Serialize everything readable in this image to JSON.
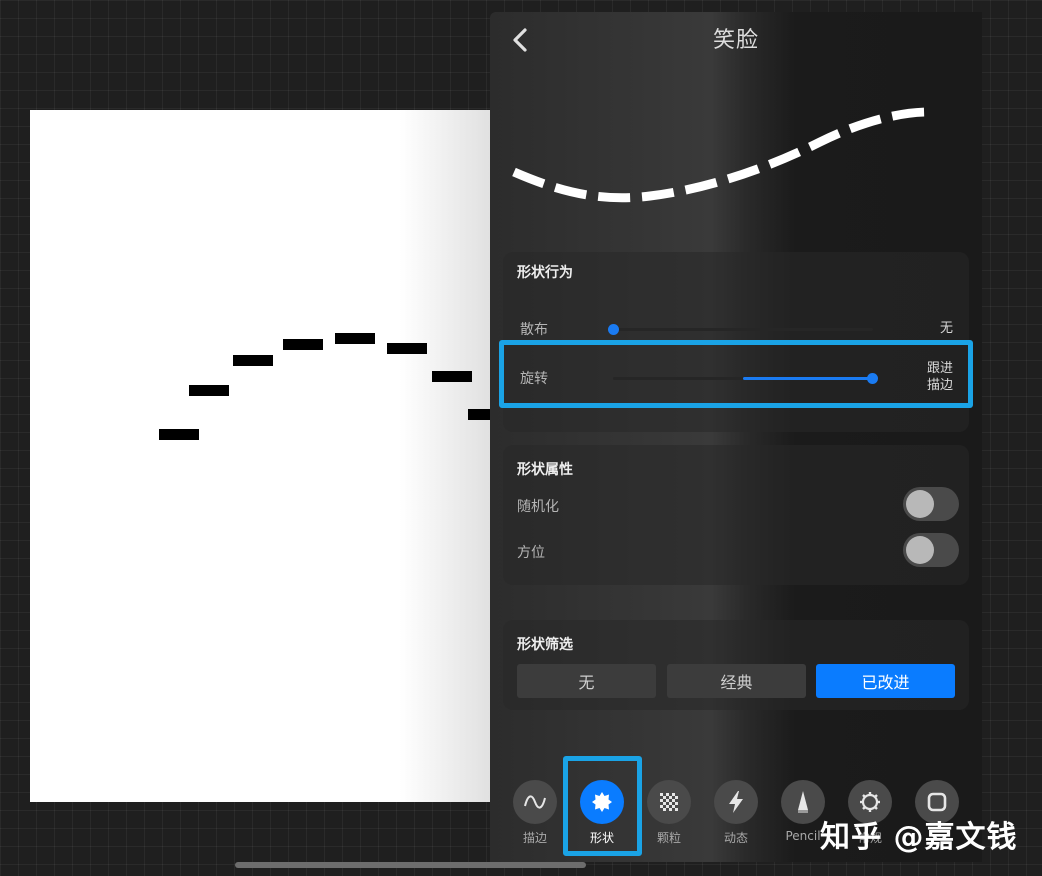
{
  "panel": {
    "title": "笑脸"
  },
  "shape_behavior": {
    "title": "形状行为",
    "scatter": {
      "label": "散布",
      "value": "无",
      "level": 0
    },
    "rotation": {
      "label": "旋转",
      "value": "跟进\n描边",
      "level": 1
    }
  },
  "shape_properties": {
    "title": "形状属性",
    "randomize": {
      "label": "随机化",
      "on": false
    },
    "azimuth": {
      "label": "方位",
      "on": false
    }
  },
  "shape_filter": {
    "title": "形状筛选",
    "options": [
      "无",
      "经典",
      "已改进"
    ],
    "selected": "已改进"
  },
  "tabs": [
    {
      "label": "描边",
      "icon": "stroke-path-icon",
      "active": false
    },
    {
      "label": "形状",
      "icon": "shape-icon",
      "active": true
    },
    {
      "label": "颗粒",
      "icon": "grain-icon",
      "active": false
    },
    {
      "label": "动态",
      "icon": "lightning-icon",
      "active": false
    },
    {
      "label": "Pencil",
      "icon": "pencil-icon",
      "active": false
    },
    {
      "label": "常规",
      "icon": "gear-icon",
      "active": false
    },
    {
      "label": "",
      "icon": "square-icon",
      "active": false
    }
  ],
  "watermark": "知乎 @嘉文钱",
  "colors": {
    "accent": "#0a7cff",
    "highlight": "#1aa3e6",
    "panel_dark": "#1a1a1a"
  }
}
